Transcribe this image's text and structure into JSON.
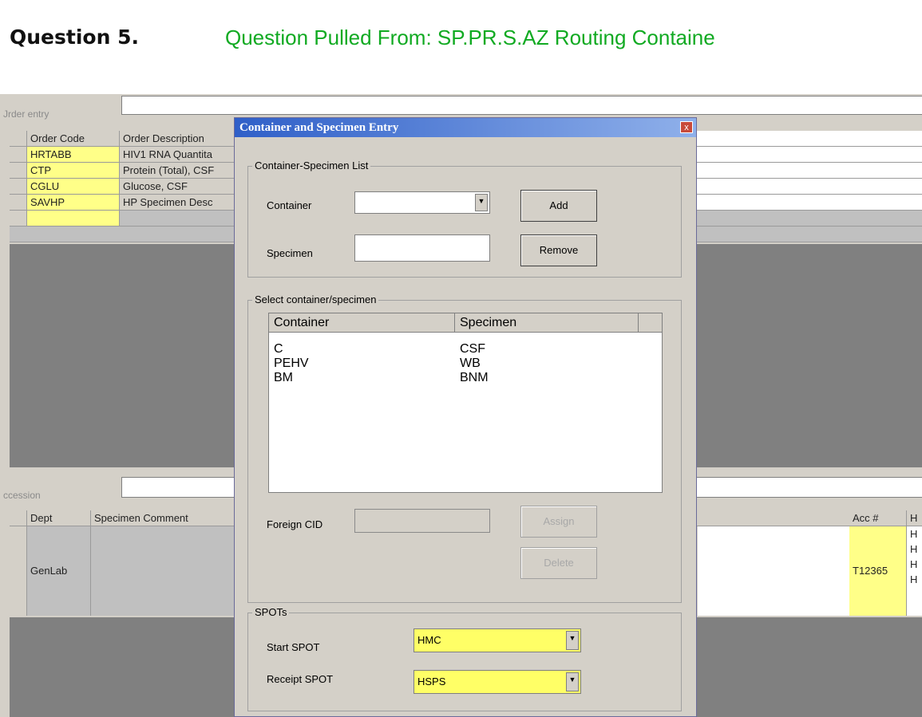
{
  "question": {
    "number": "Question 5.",
    "source": "Question Pulled From: SP.PR.S.AZ Routing Containe"
  },
  "background": {
    "order_entry_label": "Jrder entry",
    "order_columns": [
      "Order Code",
      "Order Description"
    ],
    "orders": [
      {
        "code": "HRTABB",
        "desc": "HIV1 RNA Quantita"
      },
      {
        "code": "CTP",
        "desc": "Protein (Total), CSF"
      },
      {
        "code": "CGLU",
        "desc": "Glucose, CSF"
      },
      {
        "code": "SAVHP",
        "desc": "HP Specimen Desc"
      }
    ],
    "accession_label": "ccession",
    "acc_columns": {
      "dept": "Dept",
      "comment": "Specimen Comment",
      "acc": "Acc #",
      "h": "H"
    },
    "acc_row": {
      "dept": "GenLab",
      "acc": "T12365"
    },
    "h_values": [
      "H",
      "H",
      "H",
      "H"
    ]
  },
  "dialog": {
    "title": "Container and Specimen Entry",
    "close": "x",
    "list_group": "Container-Specimen List",
    "container_label": "Container",
    "container_value": "",
    "specimen_label": "Specimen",
    "specimen_value": "",
    "add_button": "Add",
    "remove_button": "Remove",
    "select_group": "Select container/specimen",
    "columns": [
      "Container",
      "Specimen"
    ],
    "rows": [
      {
        "container": "C",
        "specimen": "CSF"
      },
      {
        "container": "PEHV",
        "specimen": "WB"
      },
      {
        "container": "BM",
        "specimen": "BNM"
      }
    ],
    "foreign_cid_label": "Foreign CID",
    "foreign_cid_value": "",
    "assign_button": "Assign",
    "delete_button": "Delete",
    "spots_group": "SPOTs",
    "start_spot_label": "Start SPOT",
    "start_spot_value": "HMC",
    "receipt_spot_label": "Receipt SPOT",
    "receipt_spot_value": "HSPS"
  }
}
